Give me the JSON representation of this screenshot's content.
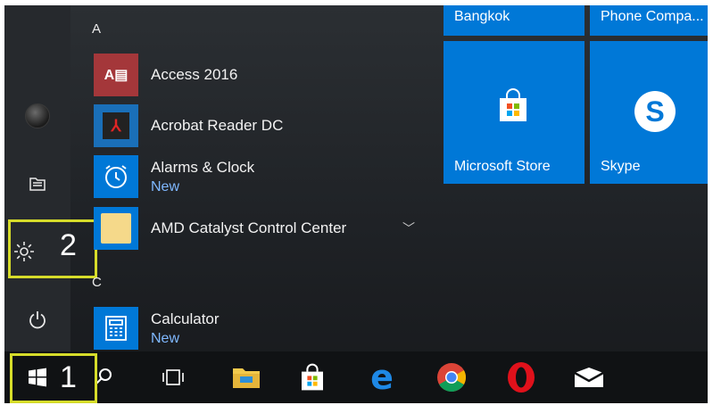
{
  "rail": {
    "settings_callout": "2"
  },
  "app_list": {
    "section_a": "A",
    "section_c": "C",
    "apps": [
      {
        "name": "Access 2016",
        "sub": ""
      },
      {
        "name": "Acrobat Reader DC",
        "sub": ""
      },
      {
        "name": "Alarms & Clock",
        "sub": "New"
      },
      {
        "name": "AMD Catalyst Control Center",
        "sub": ""
      },
      {
        "name": "Calculator",
        "sub": "New"
      }
    ],
    "expand_icon": "chevron-down-icon"
  },
  "tiles": {
    "bangkok": "Bangkok",
    "phone": "Phone Compa...",
    "store": "Microsoft Store",
    "skype": "Skype"
  },
  "taskbar": {
    "start_callout": "1",
    "icons": [
      "windows-icon",
      "search-icon",
      "task-view-icon",
      "file-explorer-icon",
      "store-icon",
      "edge-icon",
      "chrome-icon",
      "opera-icon",
      "mail-icon"
    ]
  },
  "colors": {
    "tile_blue": "#0078d7",
    "highlight": "#d6dc2a",
    "new_label": "#7fb8ff"
  }
}
